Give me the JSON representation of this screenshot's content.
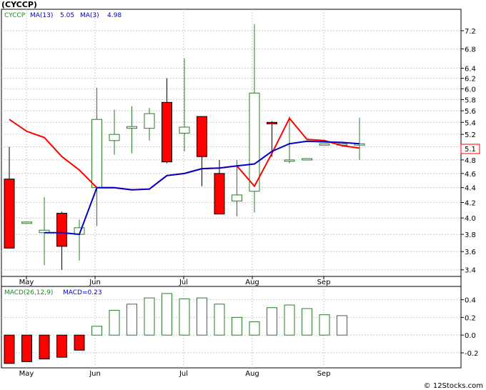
{
  "title": "(CYCCP)",
  "footer": "© 12Stocks.com",
  "colors": {
    "up_candle": "#2b7a2b",
    "down_candle": "#ff0000",
    "ma13": "#0000cc",
    "ma3": "#ff0000",
    "grid": "#c8c8c8",
    "macd_bar": "#2b7a2b",
    "macd_neg": "#ff0000",
    "legend_symbol": "#1a8a1a",
    "legend_ma": "#0000cc",
    "axis_bg": "#ffffff",
    "last_price_box": "#ff0000"
  },
  "price_panel": {
    "legend": {
      "symbol": "CYCCP",
      "ma13_label": "MA(13)",
      "ma13_value": "5.05",
      "ma3_label": "MA(3)",
      "ma3_value": "4.98"
    },
    "y_ticks": [
      "3.4",
      "3.6",
      "3.8",
      "4.0",
      "4.2",
      "4.4",
      "4.6",
      "4.8",
      "5.0",
      "5.2",
      "5.4",
      "5.6",
      "5.8",
      "6.0",
      "6.2",
      "6.4",
      "6.8",
      "7.2"
    ],
    "last_price_label": "5.1"
  },
  "macd_panel": {
    "legend": {
      "label": "MACD(26,12,9)",
      "value_label": "MACD=0.23"
    },
    "y_ticks": [
      "0.4",
      "0.2",
      "0.0",
      "-0.2"
    ]
  },
  "x_labels": [
    "May",
    "Jun",
    "Jul",
    "Aug",
    "Sep"
  ],
  "chart_data": [
    {
      "type": "candlestick",
      "title": "(CYCCP)",
      "scale": "log",
      "x": [
        "May-1",
        "May-2",
        "May-3",
        "May-4",
        "May-5",
        "Jun-1",
        "Jun-2",
        "Jun-3",
        "Jun-4",
        "Jun-5",
        "Jul-1",
        "Jul-2",
        "Jul-3",
        "Jul-4",
        "Aug-1",
        "Aug-2",
        "Aug-3",
        "Aug-4",
        "Aug-5",
        "Sep-1",
        "Sep-2"
      ],
      "open": [
        4.52,
        3.95,
        3.82,
        4.06,
        3.8,
        4.4,
        5.1,
        5.3,
        5.3,
        5.75,
        5.22,
        5.5,
        4.6,
        4.22,
        4.35,
        5.4,
        4.8,
        4.82,
        5.05,
        5.05,
        5.05
      ],
      "close": [
        3.64,
        3.95,
        3.85,
        3.66,
        3.88,
        5.45,
        5.2,
        5.33,
        5.55,
        4.77,
        5.32,
        4.85,
        4.05,
        4.3,
        5.92,
        5.38,
        4.8,
        4.82,
        5.05,
        5.05,
        5.05
      ],
      "high": [
        5.0,
        3.95,
        4.27,
        4.08,
        3.98,
        6.02,
        5.62,
        5.68,
        5.65,
        6.2,
        6.6,
        5.5,
        4.8,
        4.8,
        7.35,
        5.42,
        5.5,
        4.82,
        5.05,
        5.05,
        5.48
      ],
      "low": [
        3.64,
        3.95,
        3.45,
        3.4,
        3.5,
        3.9,
        4.88,
        4.9,
        5.1,
        4.75,
        4.93,
        4.42,
        4.05,
        4.02,
        4.07,
        4.85,
        4.75,
        4.82,
        5.05,
        5.05,
        4.8
      ],
      "ma13": {
        "name": "MA(13)",
        "values": [
          null,
          null,
          3.82,
          3.82,
          3.8,
          4.4,
          4.4,
          4.37,
          4.38,
          4.57,
          4.6,
          4.67,
          4.68,
          4.71,
          4.74,
          4.93,
          5.05,
          5.09,
          5.08,
          5.07,
          5.05
        ]
      },
      "ma3": {
        "name": "MA(3)",
        "values": [
          5.45,
          5.25,
          5.15,
          4.85,
          4.65,
          4.4,
          4.4,
          4.37,
          4.38,
          4.57,
          4.6,
          4.67,
          4.68,
          4.71,
          4.42,
          4.9,
          5.47,
          5.12,
          5.1,
          5.02,
          4.98
        ]
      },
      "ylim": [
        3.33,
        7.7
      ]
    },
    {
      "type": "bar",
      "title": "MACD(26,12,9)",
      "values": [
        -0.32,
        -0.3,
        -0.27,
        -0.25,
        -0.17,
        0.1,
        0.28,
        0.35,
        0.42,
        0.47,
        0.41,
        0.42,
        0.35,
        0.2,
        0.15,
        0.31,
        0.34,
        0.3,
        0.23,
        0.22
      ],
      "ylim": [
        -0.37,
        0.55
      ]
    }
  ]
}
